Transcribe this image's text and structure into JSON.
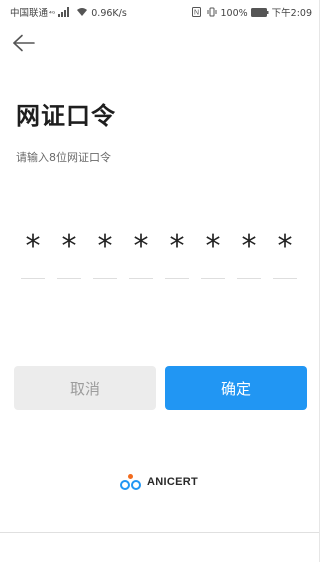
{
  "status_bar": {
    "carrier": "中国联通",
    "network": "⁴ᴳ",
    "speed": "0.96K/s",
    "nfc": "N",
    "battery_pct": "100%",
    "time": "下午2:09"
  },
  "header": {
    "back_icon": "arrow-left-icon"
  },
  "title": "网证口令",
  "subtitle": "请输入8位网证口令",
  "pin": {
    "chars": [
      "*",
      "*",
      "*",
      "*",
      "*",
      "*",
      "*",
      "*"
    ]
  },
  "buttons": {
    "cancel": "取消",
    "confirm": "确定"
  },
  "logo": {
    "text": "ANICERT"
  },
  "colors": {
    "accent": "#2196f3",
    "cancel_bg": "#ececec",
    "cancel_text": "#9c9c9c"
  }
}
